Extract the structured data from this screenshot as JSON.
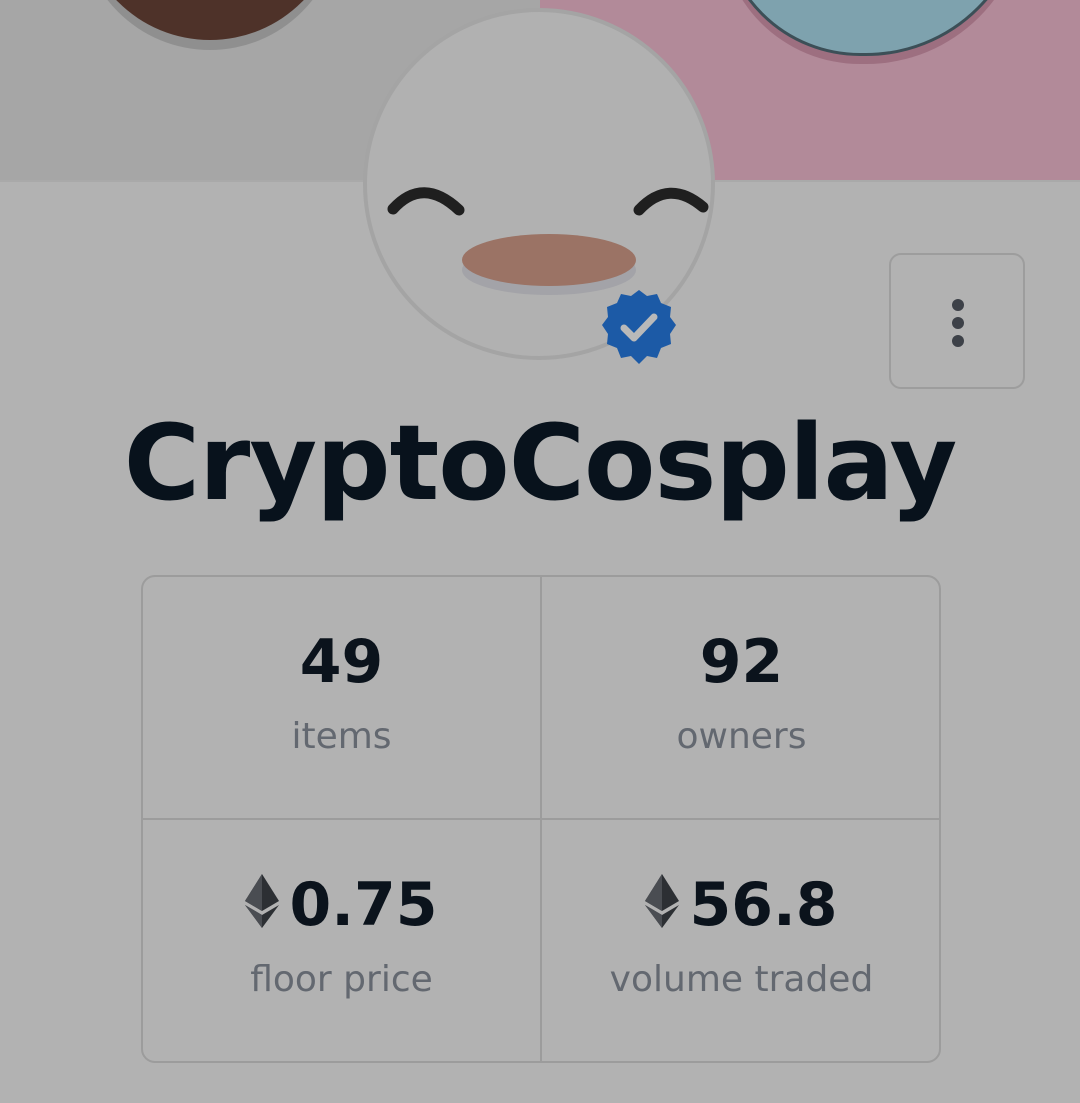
{
  "collection": {
    "name": "CryptoCosplay",
    "verified": true
  },
  "stats": {
    "items": {
      "value": "49",
      "label": "items"
    },
    "owners": {
      "value": "92",
      "label": "owners"
    },
    "floor_price": {
      "value": "0.75",
      "label": "floor price",
      "currency_icon": "ethereum-icon"
    },
    "volume_traded": {
      "value": "56.8",
      "label": "volume traded",
      "currency_icon": "ethereum-icon"
    }
  },
  "icons": {
    "more": "vertical-ellipsis-icon",
    "verified": "verified-badge-icon"
  },
  "colors": {
    "verified_badge": "#1c5aa6",
    "title_text": "#08121c",
    "label_text": "#636870",
    "overlay_background": "#b2b2b2"
  }
}
